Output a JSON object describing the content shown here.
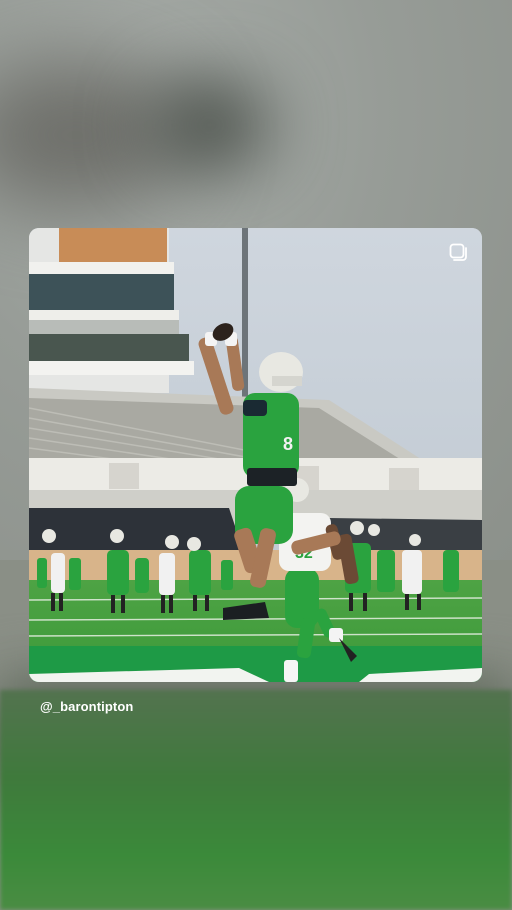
{
  "story": {
    "username": "@_barontipton",
    "multi_photo_icon": "copy-square-icon"
  },
  "jerseys": {
    "receiver_number": "8",
    "defender_number": "32"
  },
  "colors": {
    "team_green": "#2aa33f",
    "field_green": "#3aa53c",
    "helmet_white": "#e8e8e2"
  }
}
